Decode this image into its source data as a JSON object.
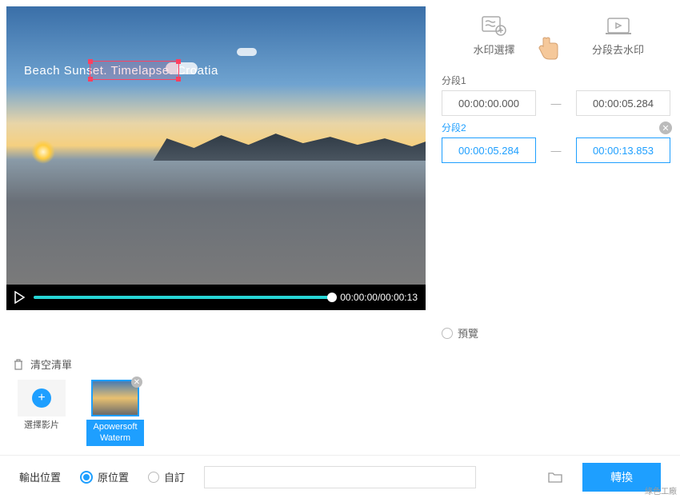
{
  "video": {
    "overlay_text": "Beach Sunset. Timelapse. Croatia",
    "current_time": "00:00:00",
    "total_time": "00:00:13"
  },
  "tabs": {
    "watermark_select": "水印選擇",
    "segment_remove": "分段去水印"
  },
  "segments": [
    {
      "label": "分段1",
      "start": "00:00:00.000",
      "end": "00:00:05.284",
      "active": false
    },
    {
      "label": "分段2",
      "start": "00:00:05.284",
      "end": "00:00:13.853",
      "active": true
    }
  ],
  "preview_label": "預覽",
  "clear_list": "清空清單",
  "thumbs": {
    "add_label": "選擇影片",
    "video_label": "Apowersoft Waterm"
  },
  "footer": {
    "output_label": "輸出位置",
    "original_location": "原位置",
    "custom": "自訂",
    "convert": "轉換"
  },
  "corner_text": "綠色工廠"
}
